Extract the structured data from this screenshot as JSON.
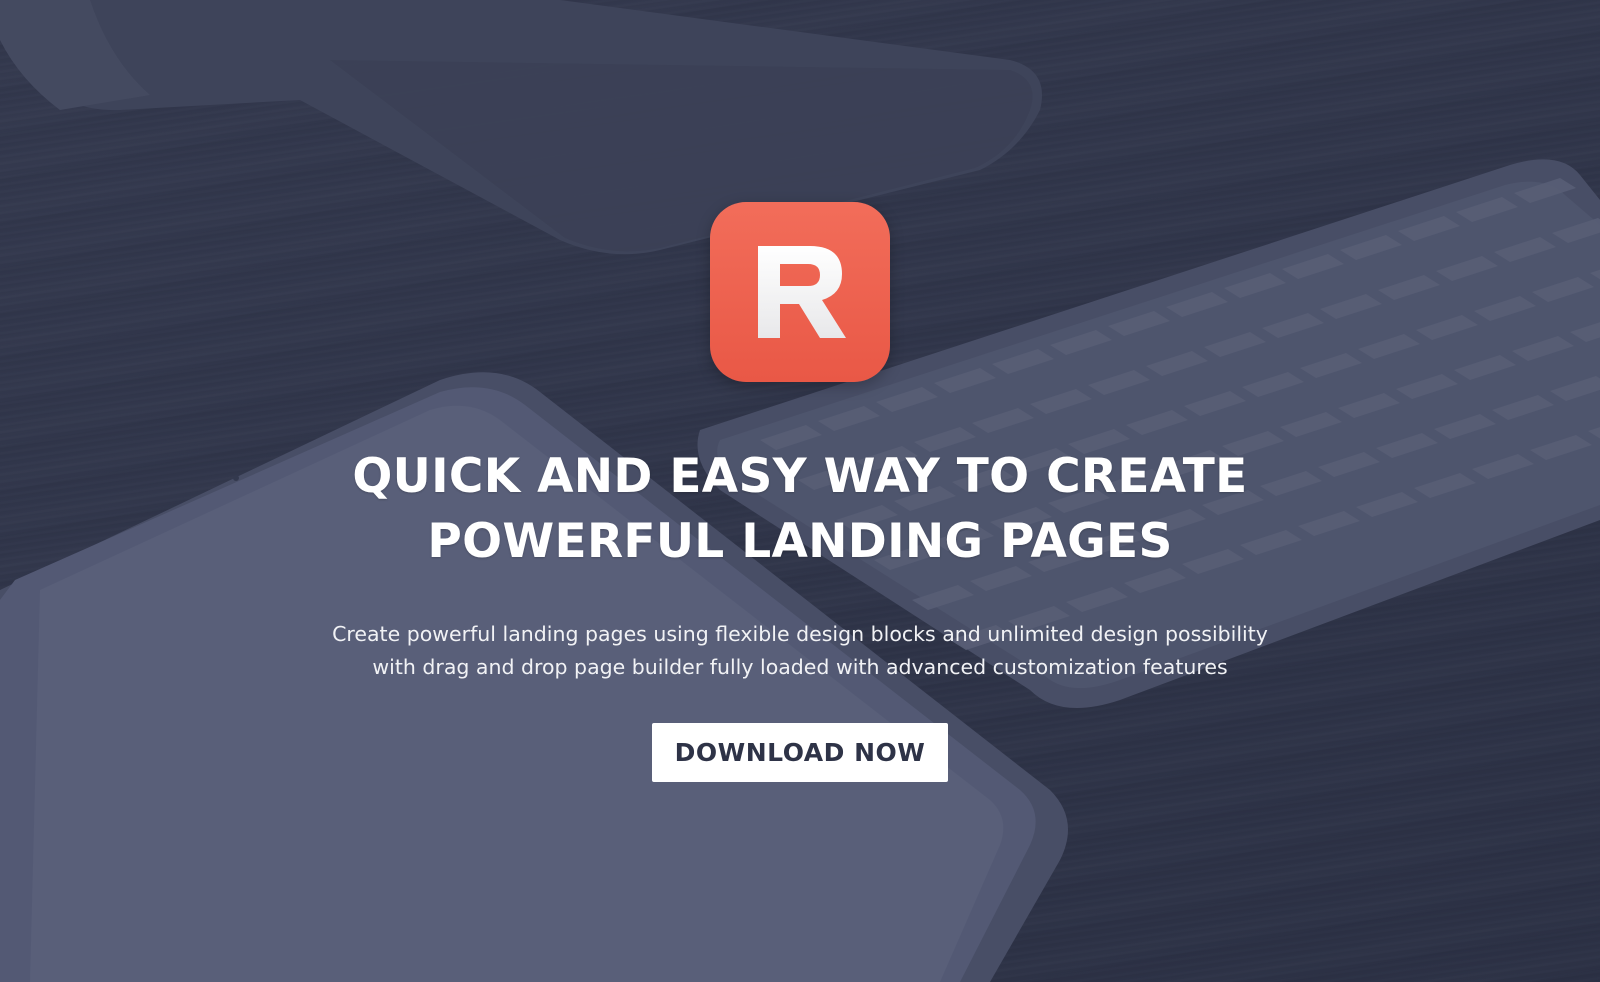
{
  "hero": {
    "logo_letter": "R",
    "headline_line1": "QUICK AND EASY WAY TO CREATE",
    "headline_line2": "POWERFUL LANDING PAGES",
    "subtext_line1": "Create powerful landing pages using flexible design blocks and unlimited design possibility",
    "subtext_line2": "with drag and drop page builder fully loaded with advanced customization features",
    "cta_label": "DOWNLOAD NOW"
  },
  "colors": {
    "background": "#353a4f",
    "logo_accent": "#ee6150",
    "text": "#ffffff",
    "button_bg": "#ffffff",
    "button_text": "#2e3347"
  }
}
